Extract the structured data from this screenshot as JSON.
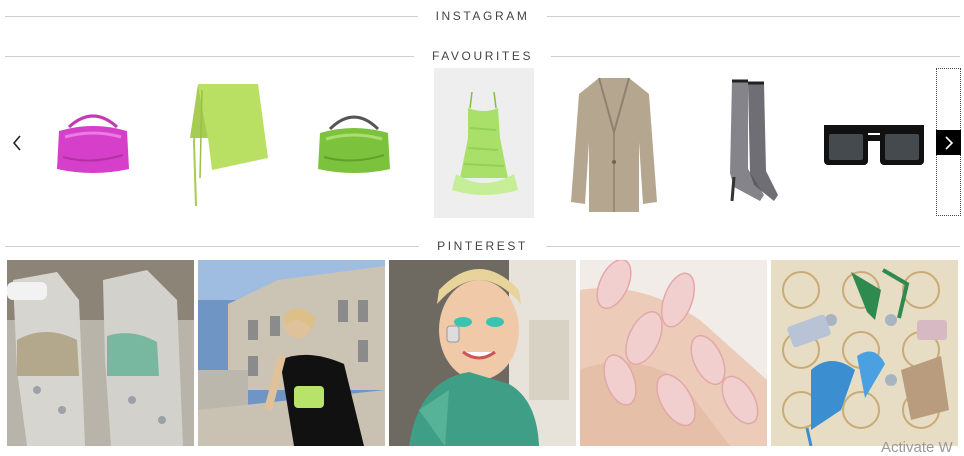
{
  "sections": {
    "instagram": "INSTAGRAM",
    "favourites": "FAVOURITES",
    "pinterest": "PINTEREST"
  },
  "favourites": {
    "items": [
      {
        "name": "pink-metallic-bag",
        "color": "#d63fc9"
      },
      {
        "name": "lime-wrap-skirt",
        "color": "#b9e062"
      },
      {
        "name": "green-metallic-bag",
        "color": "#7cc23c"
      },
      {
        "name": "green-feather-dress",
        "color": "#a8e06a"
      },
      {
        "name": "beige-blazer",
        "color": "#b5a78f"
      },
      {
        "name": "mesh-boots",
        "color": "#6e6e76"
      },
      {
        "name": "black-sunglasses",
        "color": "#111111"
      }
    ],
    "prev_icon": "chevron-left-icon",
    "next_icon": "chevron-right-icon"
  },
  "pinterest": {
    "pins": [
      {
        "name": "street-style-pin"
      },
      {
        "name": "paris-black-dress-pin"
      },
      {
        "name": "green-makeup-pin"
      },
      {
        "name": "pink-nails-pin"
      },
      {
        "name": "blue-heels-pin"
      }
    ]
  },
  "watermark": "Activate W"
}
